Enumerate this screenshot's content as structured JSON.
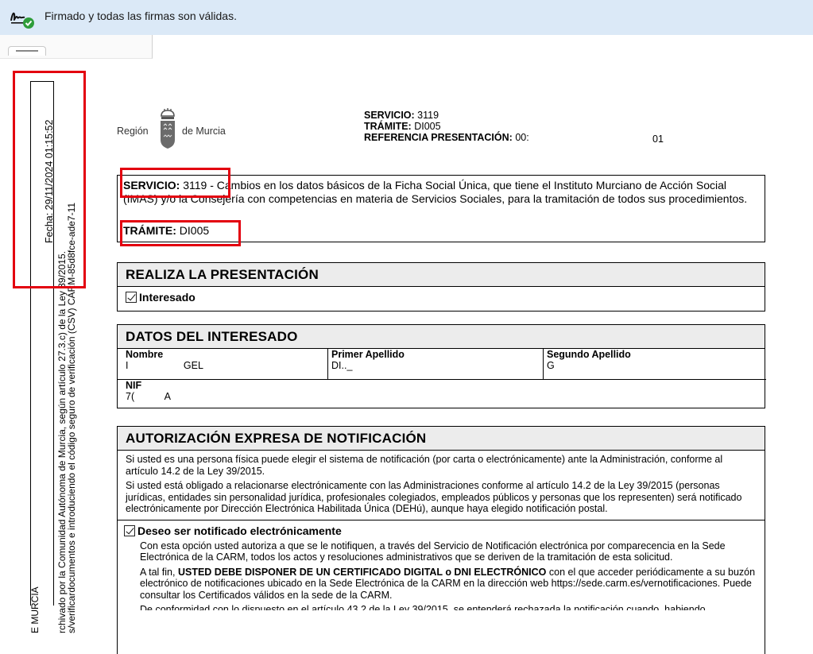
{
  "signature_bar": {
    "message": "Firmado y todas las firmas son válidas.",
    "icon": "signature-valid-icon"
  },
  "margin": {
    "fecha": "Fecha: 29/11/2024 01:15:52",
    "line1": "rchivado por la Comunidad Autónoma de Murcia, según artículo 27.3.c) de la Ley 39/2015.",
    "line2": "s/verificardocumentos e introduciendo el código seguro de verificación (CSV) CARM-85d8fce-ade7-11",
    "line3": "E MURCIA"
  },
  "logo": {
    "left": "Región",
    "right": "de Murcia"
  },
  "header": {
    "servicio_label": "SERVICIO:",
    "servicio_value": "3119",
    "tramite_label": "TRÁMITE:",
    "tramite_value": "DI005",
    "referencia_label": "REFERENCIA PRESENTACIÓN:",
    "referencia_value": "00:",
    "referencia_tail": "01"
  },
  "service_box": {
    "servicio_label": "SERVICIO:",
    "servicio_value": "3119",
    "description": " - Cambios en los datos básicos de la Ficha Social Única, que tiene el Instituto Murciano de Acción Social (IMAS) y/o la Consejería con competencias en materia de Servicios Sociales, para la tramitación de todos sus procedimientos.",
    "tramite_label": "TRÁMITE:",
    "tramite_value": "DI005"
  },
  "realiza": {
    "title": "REALIZA LA PRESENTACIÓN",
    "option": "Interesado"
  },
  "interesado": {
    "title": "DATOS DEL INTERESADO",
    "nombre_label": "Nombre",
    "nombre_value": "I                    GEL",
    "apellido1_label": "Primer Apellido",
    "apellido1_value": "DI.._",
    "apellido2_label": "Segundo Apellido",
    "apellido2_value": "G",
    "nif_label": "NIF",
    "nif_value": "7(           A"
  },
  "autorizacion": {
    "title": "AUTORIZACIÓN EXPRESA DE NOTIFICACIÓN",
    "p1": "Si usted es una persona física puede elegir el sistema de notificación (por carta o electrónicamente) ante la Administración, conforme al artículo 14.2 de la Ley 39/2015.",
    "p2": "Si usted está obligado a relacionarse electrónicamente con las Administraciones conforme al artículo 14.2 de la Ley 39/2015 (personas jurídicas, entidades sin personalidad jurídica, profesionales colegiados, empleados públicos y personas que los representen) será notificado electrónicamente por Dirección Electrónica Habilitada Única (DEHú), aunque haya elegido notificación postal.",
    "option": "Deseo ser notificado electrónicamente",
    "b1": "Con esta opción usted autoriza a que se le notifiquen, a través del Servicio de Notificación electrónica por comparecencia en la Sede Electrónica de la CARM, todos los actos y resoluciones administrativos que se deriven de la tramitación de esta solicitud.",
    "b2_pre": "A tal fin, ",
    "b2_bold": "USTED DEBE DISPONER DE UN CERTIFICADO DIGITAL o DNI ELECTRÓNICO",
    "b2_post": " con el que acceder periódicamente a su buzón electrónico de notificaciones ubicado en la Sede Electrónica de la CARM en la dirección web https://sede.carm.es/vernotificaciones. Puede consultar los Certificados válidos en la sede de la CARM.",
    "b3_partial": "De conformidad con lo dispuesto en el artículo 43.2 de la Ley 39/2015, se entenderá rechazada la notificación cuando, habiendo"
  },
  "colors": {
    "highlight": "#e3000f",
    "bar": "#dbe9f7",
    "section_head": "#ececec"
  }
}
